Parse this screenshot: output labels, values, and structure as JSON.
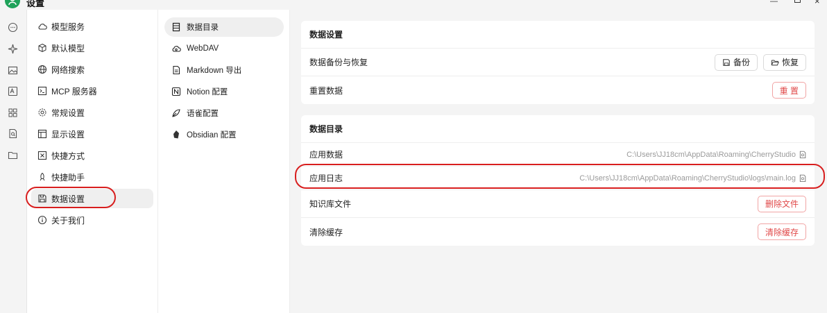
{
  "window": {
    "title": "设置"
  },
  "menu": {
    "items": [
      {
        "label": "模型服务",
        "icon": "cloud-icon"
      },
      {
        "label": "默认模型",
        "icon": "cube-icon"
      },
      {
        "label": "网络搜索",
        "icon": "globe-icon"
      },
      {
        "label": "MCP 服务器",
        "icon": "terminal-icon"
      },
      {
        "label": "常规设置",
        "icon": "gear-icon"
      },
      {
        "label": "显示设置",
        "icon": "layout-icon"
      },
      {
        "label": "快捷方式",
        "icon": "command-icon"
      },
      {
        "label": "快捷助手",
        "icon": "rocket-icon"
      },
      {
        "label": "数据设置",
        "icon": "save-icon",
        "active": true
      },
      {
        "label": "关于我们",
        "icon": "info-icon"
      }
    ]
  },
  "submenu": {
    "items": [
      {
        "label": "数据目录",
        "icon": "folder-list-icon",
        "active": true
      },
      {
        "label": "WebDAV",
        "icon": "cloud-sync-icon"
      },
      {
        "label": "Markdown 导出",
        "icon": "file-text-icon"
      },
      {
        "label": "Notion 配置",
        "icon": "notion-icon"
      },
      {
        "label": "语雀配置",
        "icon": "yuque-icon"
      },
      {
        "label": "Obsidian 配置",
        "icon": "obsidian-icon"
      }
    ]
  },
  "data_settings": {
    "title": "数据设置",
    "backup_row": {
      "label": "数据备份与恢复",
      "backup_btn": "备份",
      "restore_btn": "恢复"
    },
    "reset_row": {
      "label": "重置数据",
      "reset_btn": "重 置"
    }
  },
  "data_dir": {
    "title": "数据目录",
    "app_data": {
      "label": "应用数据",
      "path": "C:\\Users\\JJ18cm\\AppData\\Roaming\\CherryStudio"
    },
    "app_log": {
      "label": "应用日志",
      "path": "C:\\Users\\JJ18cm\\AppData\\Roaming\\CherryStudio\\logs\\main.log"
    },
    "kb_files": {
      "label": "知识库文件",
      "btn": "删除文件"
    },
    "clear_cache": {
      "label": "清除缓存",
      "btn": "清除缓存"
    }
  },
  "colors": {
    "danger": "#e04848",
    "highlight": "#d81e1e",
    "avatar": "#1fa25a"
  }
}
